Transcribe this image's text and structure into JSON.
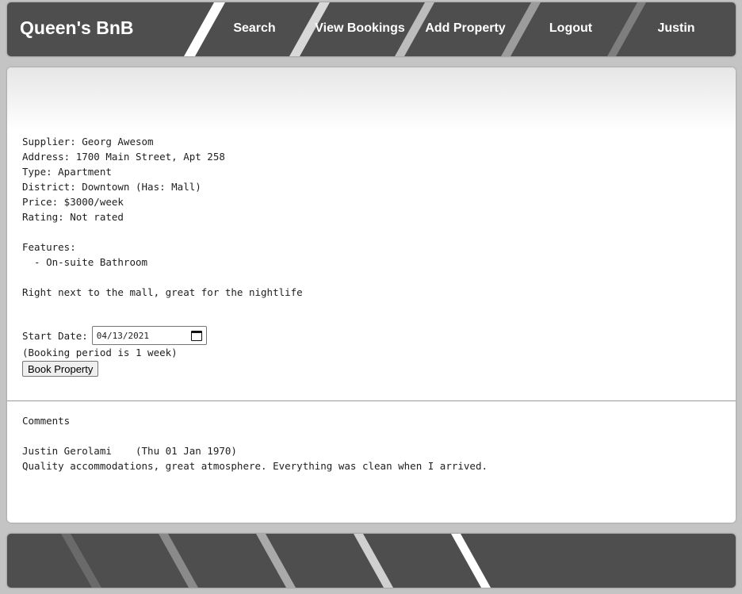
{
  "header": {
    "brand": "Queen's BnB",
    "nav": {
      "search": "Search",
      "view_bookings": "View Bookings",
      "add_property": "Add Property",
      "logout": "Logout",
      "user": "Justin"
    }
  },
  "property": {
    "supplier": "Supplier: Georg Awesom",
    "address": "Address: 1700 Main Street, Apt 258",
    "type": "Type: Apartment",
    "district": "District: Downtown (Has: Mall)",
    "price": "Price: $3000/week",
    "rating": "Rating: Not rated",
    "features_label": "Features:",
    "features": [
      "  - On-suite Bathroom"
    ],
    "description": "Right next to the mall, great for the nightlife"
  },
  "booking": {
    "start_label": "Start Date:",
    "start_value": "04/13/2021",
    "period_note": "(Booking period is 1 week)",
    "button": "Book Property"
  },
  "comments": {
    "heading": "Comments",
    "items": [
      {
        "author_line": "Justin Gerolami    (Thu 01 Jan 1970)",
        "text": "Quality accommodations, great atmosphere. Everything was clean when I arrived."
      }
    ]
  },
  "colors": {
    "bar": "#4e4e4e",
    "page_bg": "#c4c4c4",
    "panel": "#ffffff"
  },
  "icons": [
    "calendar-icon"
  ]
}
